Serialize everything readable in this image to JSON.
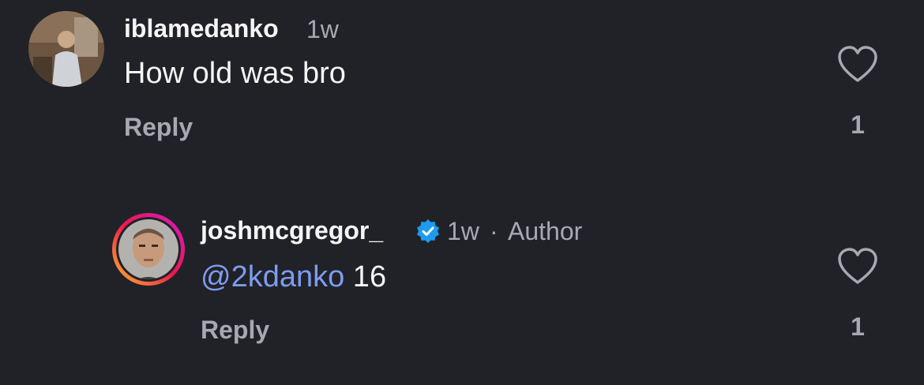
{
  "comments": [
    {
      "username": "iblamedanko",
      "time": "1w",
      "text": "How old was bro",
      "reply_label": "Reply",
      "like_count": "1"
    },
    {
      "username": "joshmcgregor_",
      "time": "1w",
      "separator": "·",
      "author_tag": "Author",
      "mention": "@2kdanko",
      "text": " 16",
      "reply_label": "Reply",
      "like_count": "1",
      "verified": true
    }
  ],
  "colors": {
    "background": "#212227",
    "mention": "#7d9cf0",
    "verified": "#1d9bf0",
    "muted": "#a8a8b0"
  }
}
